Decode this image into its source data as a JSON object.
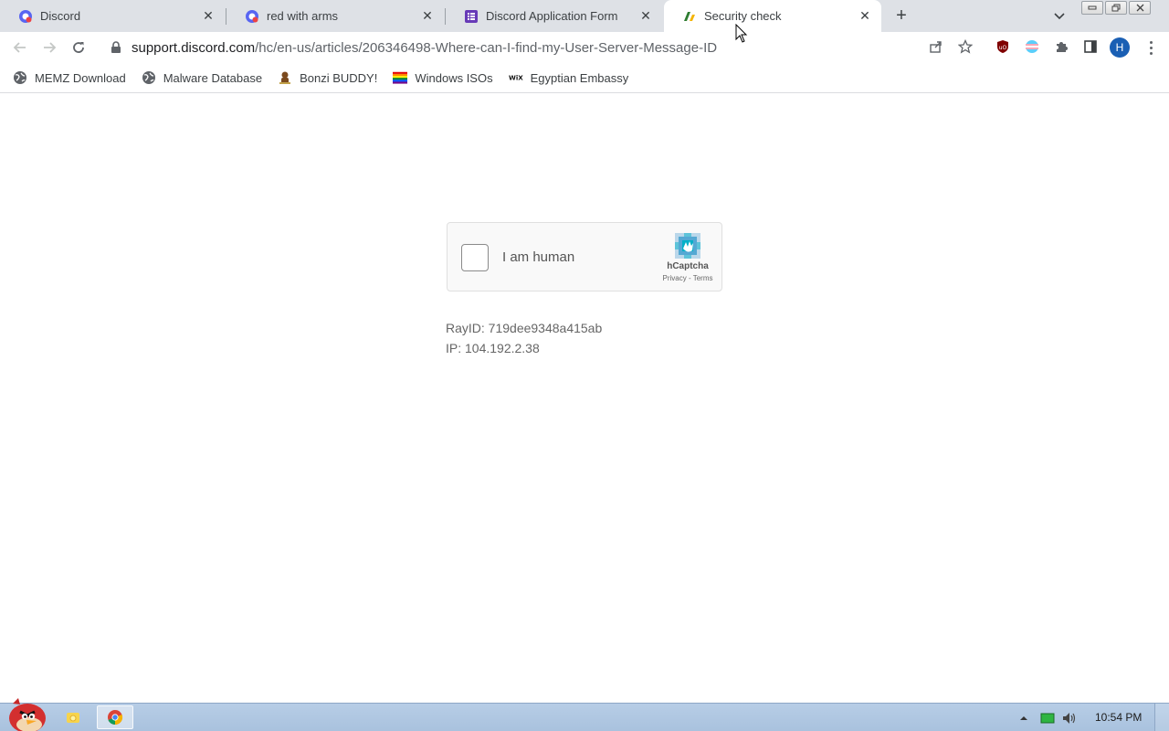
{
  "browser": {
    "tabs": [
      {
        "title": "Discord",
        "favicon": "discord-favicon"
      },
      {
        "title": "red with arms",
        "favicon": "discord-favicon"
      },
      {
        "title": "Discord Application Form",
        "favicon": "forms-favicon"
      },
      {
        "title": "Security check",
        "favicon": "cloudflare-favicon",
        "active": true
      }
    ],
    "new_tab_symbol": "+",
    "close_symbol": "✕",
    "url_host": "support.discord.com",
    "url_path": "/hc/en-us/articles/206346498-Where-can-I-find-my-User-Server-Message-ID",
    "profile_initial": "H",
    "accent_color": "#1a5fb4"
  },
  "bookmarks": [
    {
      "label": "MEMZ Download",
      "icon": "globe-icon"
    },
    {
      "label": "Malware Database",
      "icon": "globe-icon"
    },
    {
      "label": "Bonzi BUDDY!",
      "icon": "bonzi-icon"
    },
    {
      "label": "Windows ISOs",
      "icon": "rainbow-flag-icon"
    },
    {
      "label": "Egyptian Embassy",
      "icon": "wix-icon"
    }
  ],
  "page": {
    "captcha": {
      "checkbox_label": "I am human",
      "brand": "hCaptcha",
      "privacy": "Privacy",
      "separator": " - ",
      "terms": "Terms"
    },
    "ray_id": "RayID: 719dee9348a415ab",
    "ip": "IP: 104.192.2.38"
  },
  "taskbar": {
    "clock": "10:54 PM"
  }
}
